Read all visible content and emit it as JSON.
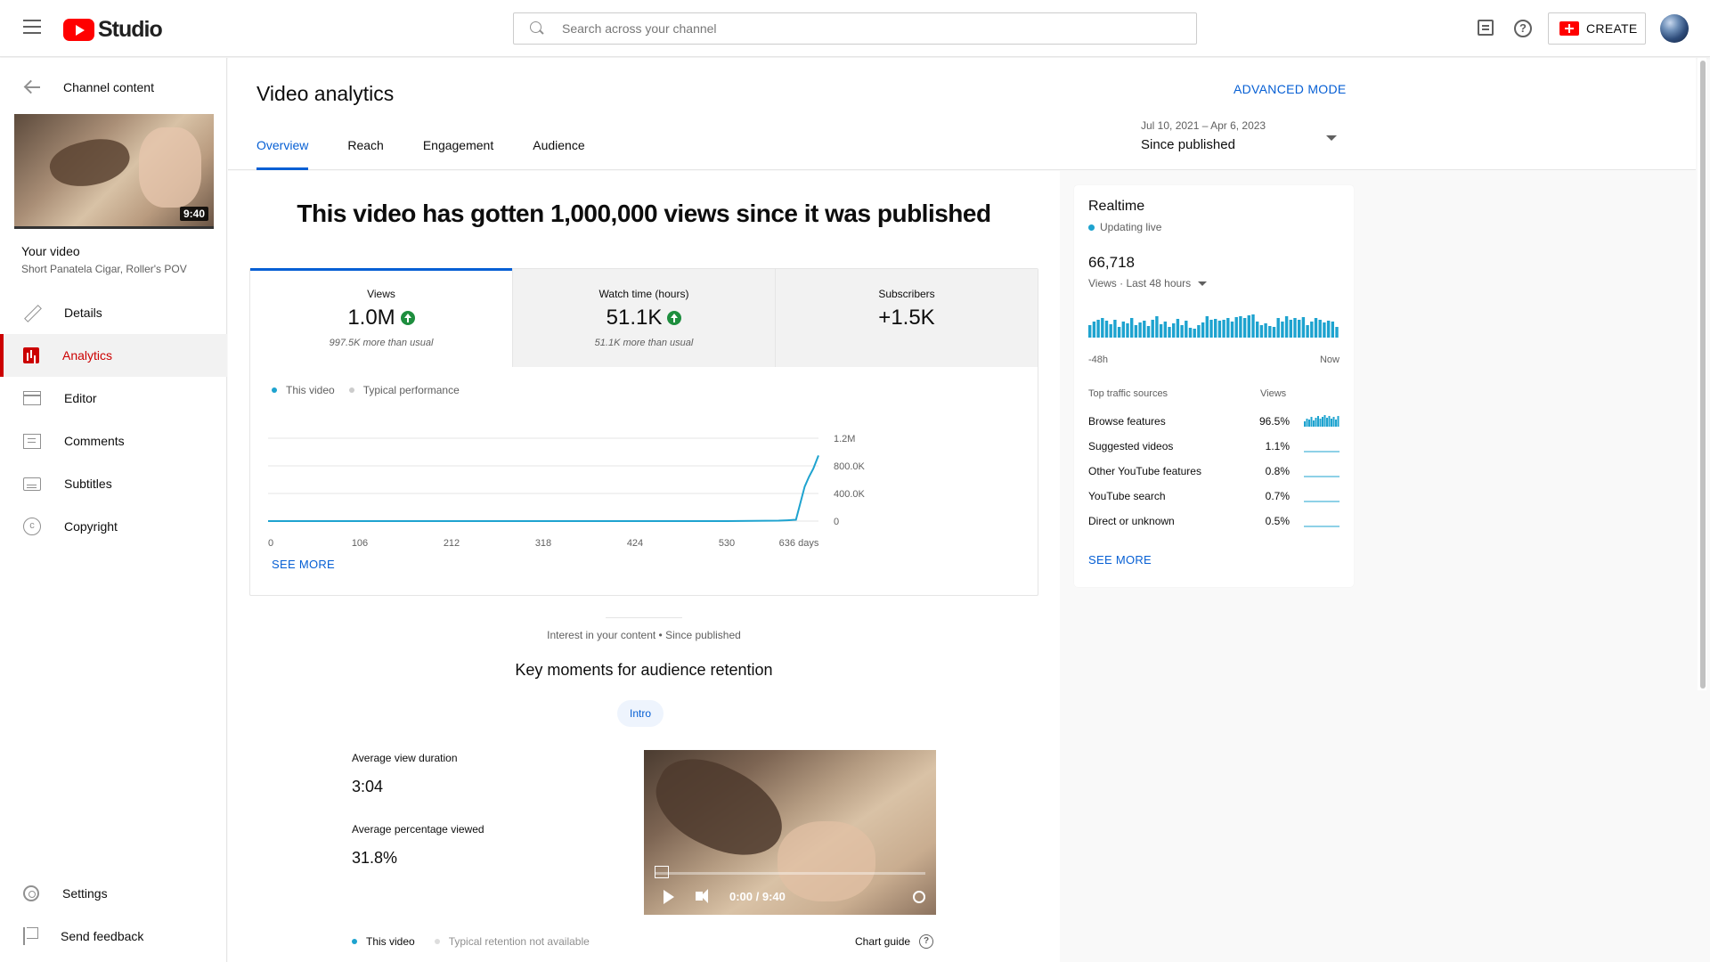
{
  "header": {
    "logo_text": "Studio",
    "search_placeholder": "Search across your channel",
    "create_label": "CREATE"
  },
  "sidebar": {
    "back_label": "Channel content",
    "thumbnail_duration": "9:40",
    "your_video_label": "Your video",
    "video_title": "Short Panatela Cigar, Roller's POV",
    "items": [
      {
        "label": "Details",
        "icon": "pencil-icon",
        "active": false
      },
      {
        "label": "Analytics",
        "icon": "analytics-icon",
        "active": true
      },
      {
        "label": "Editor",
        "icon": "editor-icon",
        "active": false
      },
      {
        "label": "Comments",
        "icon": "comments-icon",
        "active": false
      },
      {
        "label": "Subtitles",
        "icon": "subtitles-icon",
        "active": false
      },
      {
        "label": "Copyright",
        "icon": "copyright-icon",
        "active": false
      }
    ],
    "bottom_items": [
      {
        "label": "Settings",
        "icon": "gear-icon"
      },
      {
        "label": "Send feedback",
        "icon": "feedback-flag-icon"
      }
    ]
  },
  "page": {
    "title": "Video analytics",
    "advanced_mode": "ADVANCED MODE",
    "tabs": [
      "Overview",
      "Reach",
      "Engagement",
      "Audience"
    ],
    "active_tab": "Overview",
    "date_range": "Jul 10, 2021 – Apr 6, 2023",
    "date_label": "Since published"
  },
  "overview": {
    "headline": "This video has gotten 1,000,000 views since it was published",
    "metrics": [
      {
        "label": "Views",
        "value": "1.0M",
        "sub": "997.5K more than usual",
        "trend": "up"
      },
      {
        "label": "Watch time (hours)",
        "value": "51.1K",
        "sub": "51.1K more than usual",
        "trend": "up"
      },
      {
        "label": "Subscribers",
        "value": "+1.5K",
        "sub": "",
        "trend": "none"
      }
    ],
    "legend": {
      "this_video": "This video",
      "typical": "Typical performance"
    },
    "see_more": "SEE MORE"
  },
  "chart_data": {
    "type": "line",
    "x": [
      0,
      106,
      212,
      318,
      424,
      530,
      560,
      590,
      600,
      610,
      620,
      625,
      630,
      636
    ],
    "series": [
      {
        "name": "This video",
        "values": [
          0,
          0,
          0,
          0,
          0,
          0,
          4000,
          6000,
          12000,
          20000,
          500000,
          640000,
          760000,
          950000
        ]
      }
    ],
    "xticks": [
      "0",
      "106",
      "212",
      "318",
      "424",
      "530",
      "636 days"
    ],
    "yticks": [
      "0",
      "400.0K",
      "800.0K",
      "1.2M"
    ],
    "ylim": [
      0,
      1200000
    ],
    "xlim": [
      0,
      636
    ],
    "grid": true,
    "color": "#1ea3cf"
  },
  "retention": {
    "interest_label": "Interest in your content • Since published",
    "title": "Key moments for audience retention",
    "chip": "Intro",
    "avd_label": "Average view duration",
    "avd_value": "3:04",
    "apv_label": "Average percentage viewed",
    "apv_value": "31.8%",
    "player_time": "0:00 / 9:40",
    "legend_this": "This video",
    "legend_typical": "Typical retention not available",
    "chart_guide": "Chart guide"
  },
  "realtime": {
    "title": "Realtime",
    "live_label": "Updating live",
    "count": "66,718",
    "sub_label": "Views · Last 48 hours",
    "axis_left": "-48h",
    "axis_right": "Now",
    "bar_values": [
      14,
      18,
      20,
      22,
      19,
      15,
      20,
      12,
      18,
      16,
      22,
      14,
      17,
      19,
      13,
      20,
      24,
      15,
      18,
      12,
      16,
      21,
      14,
      19,
      11,
      10,
      14,
      17,
      24,
      20,
      21,
      19,
      20,
      22,
      18,
      23,
      24,
      22,
      25,
      26,
      18,
      14,
      16,
      13,
      12,
      22,
      18,
      24,
      20,
      22,
      20,
      23,
      14,
      18,
      22,
      20,
      17,
      19,
      18,
      12
    ],
    "bar_max": 26,
    "traffic_header": "Top traffic sources",
    "views_header": "Views",
    "sources": [
      {
        "name": "Browse features",
        "value": "96.5%"
      },
      {
        "name": "Suggested videos",
        "value": "1.1%"
      },
      {
        "name": "Other YouTube features",
        "value": "0.8%"
      },
      {
        "name": "YouTube search",
        "value": "0.7%"
      },
      {
        "name": "Direct or unknown",
        "value": "0.5%"
      }
    ],
    "see_more": "SEE MORE"
  },
  "colors": {
    "accent": "#065fd4",
    "brand_red": "#ff0000",
    "sidebar_active": "#cc0000",
    "series": "#1ea3cf",
    "typical": "#cccccc",
    "up_green": "#1e8e3e"
  }
}
